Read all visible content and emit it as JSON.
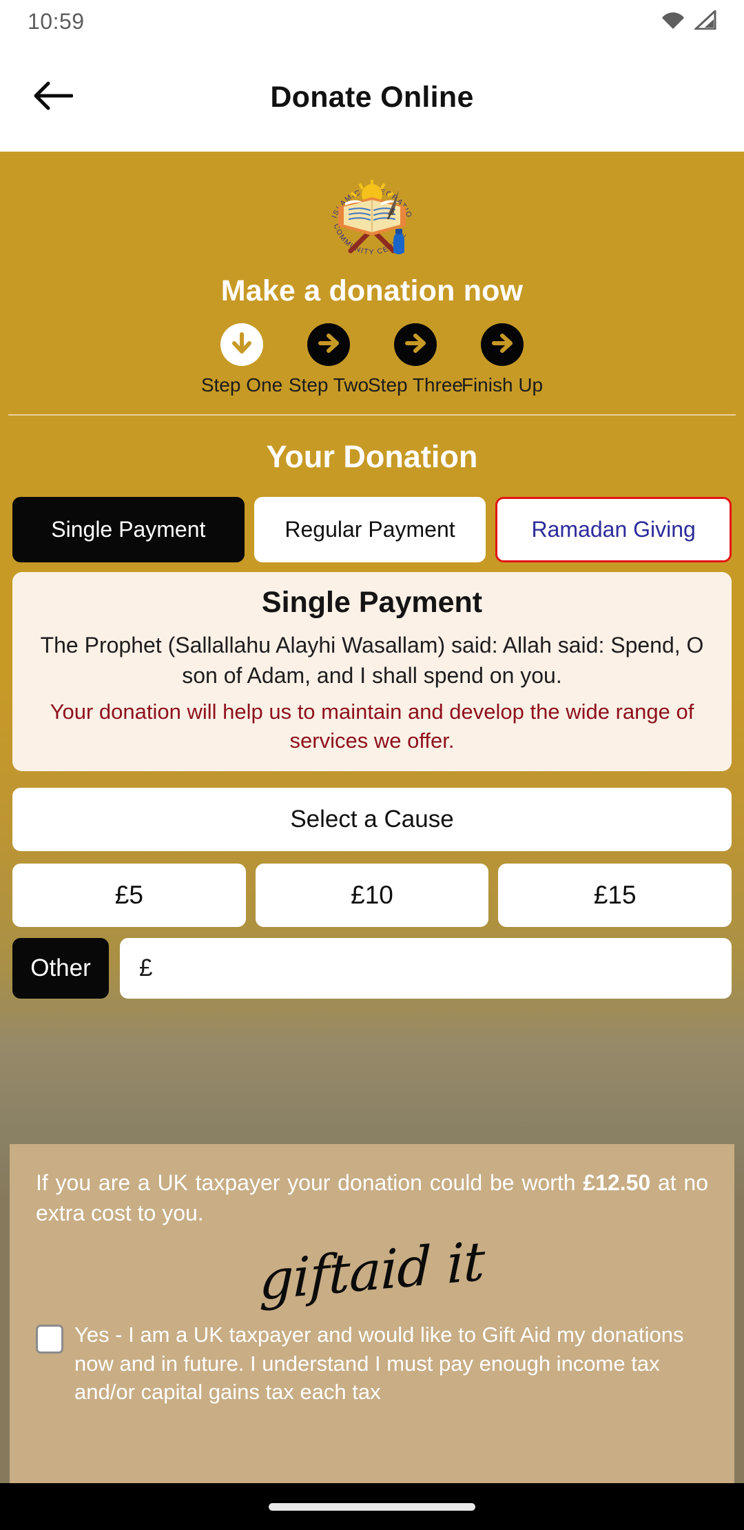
{
  "status_bar": {
    "time": "10:59",
    "icons": [
      "wifi-icon",
      "cellular-signal-icon"
    ]
  },
  "app_bar": {
    "back_icon": "back-arrow-icon",
    "title": "Donate Online"
  },
  "hero": {
    "logo_alt": "Islamic Integration Community Centre logo",
    "logo_text_top": "ISLAMIC INTEGRATION",
    "logo_text_bottom": "COMMUNITY CENTRE",
    "title": "Make a donation now"
  },
  "steps": [
    {
      "label": "Step One",
      "state": "active",
      "icon": "arrow-down-icon"
    },
    {
      "label": "Step Two",
      "state": "inactive",
      "icon": "arrow-right-icon"
    },
    {
      "label": "Step Three",
      "state": "inactive",
      "icon": "arrow-right-icon"
    },
    {
      "label": "Finish Up",
      "state": "inactive",
      "icon": "arrow-right-icon"
    }
  ],
  "section": {
    "title": "Your Donation"
  },
  "tabs": [
    {
      "label": "Single Payment",
      "state": "active"
    },
    {
      "label": "Regular Payment",
      "state": "plain"
    },
    {
      "label": "Ramadan Giving",
      "state": "accent"
    }
  ],
  "info_card": {
    "heading": "Single Payment",
    "quote": "The Prophet (Sallallahu Alayhi Wasallam) said: Allah said: Spend, O son of Adam, and I shall spend on you.",
    "highlight": "Your donation will help us to maintain and develop the wide range of services we offer."
  },
  "cause": {
    "selected": "Select a Cause"
  },
  "amounts": [
    {
      "label": "£5"
    },
    {
      "label": "£10"
    },
    {
      "label": "£15"
    }
  ],
  "other": {
    "button_label": "Other",
    "input_value": "£",
    "input_placeholder": "£"
  },
  "gift_aid": {
    "intro_before": "If you are a UK taxpayer your donation could be worth ",
    "intro_amount": "£12.50",
    "intro_after": " at no extra cost to you.",
    "logo_text": "giftaid it",
    "consent": "Yes - I am a UK taxpayer and would like to Gift Aid my donations now and in future. I understand I must pay enough income tax and/or capital gains tax each tax",
    "checked": false
  },
  "nav_bar": {
    "gesture_pill": "home-gesture-pill"
  },
  "colors": {
    "gold": "#c79a26",
    "olive": "#877a5c",
    "tan": "#c8ad85",
    "cream": "#fbf1e7",
    "crimson": "#8e0f1c",
    "accent_red": "#e31414",
    "accent_blue": "#2b2b9c",
    "black": "#080808",
    "white": "#ffffff"
  }
}
